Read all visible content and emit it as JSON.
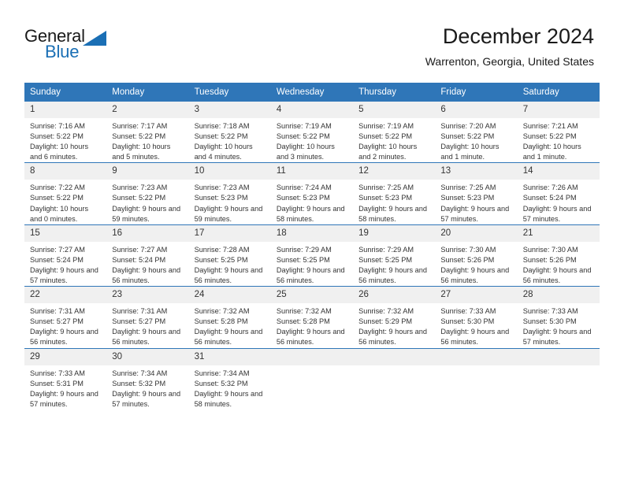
{
  "brand": {
    "name_part1": "General",
    "name_part2": "Blue",
    "triangle_color": "#1a6fb5",
    "text_color_primary": "#1a1a1a",
    "text_color_accent": "#1a6fb5"
  },
  "header": {
    "title": "December 2024",
    "subtitle": "Warrenton, Georgia, United States"
  },
  "theme": {
    "header_bg": "#2f76b8",
    "header_text": "#ffffff",
    "day_number_bg": "#f0f0f0",
    "row_divider": "#2f76b8",
    "body_text": "#333333"
  },
  "calendar": {
    "weekdays": [
      "Sunday",
      "Monday",
      "Tuesday",
      "Wednesday",
      "Thursday",
      "Friday",
      "Saturday"
    ],
    "weeks": [
      [
        {
          "day": "1",
          "sunrise": "Sunrise: 7:16 AM",
          "sunset": "Sunset: 5:22 PM",
          "daylight": "Daylight: 10 hours and 6 minutes."
        },
        {
          "day": "2",
          "sunrise": "Sunrise: 7:17 AM",
          "sunset": "Sunset: 5:22 PM",
          "daylight": "Daylight: 10 hours and 5 minutes."
        },
        {
          "day": "3",
          "sunrise": "Sunrise: 7:18 AM",
          "sunset": "Sunset: 5:22 PM",
          "daylight": "Daylight: 10 hours and 4 minutes."
        },
        {
          "day": "4",
          "sunrise": "Sunrise: 7:19 AM",
          "sunset": "Sunset: 5:22 PM",
          "daylight": "Daylight: 10 hours and 3 minutes."
        },
        {
          "day": "5",
          "sunrise": "Sunrise: 7:19 AM",
          "sunset": "Sunset: 5:22 PM",
          "daylight": "Daylight: 10 hours and 2 minutes."
        },
        {
          "day": "6",
          "sunrise": "Sunrise: 7:20 AM",
          "sunset": "Sunset: 5:22 PM",
          "daylight": "Daylight: 10 hours and 1 minute."
        },
        {
          "day": "7",
          "sunrise": "Sunrise: 7:21 AM",
          "sunset": "Sunset: 5:22 PM",
          "daylight": "Daylight: 10 hours and 1 minute."
        }
      ],
      [
        {
          "day": "8",
          "sunrise": "Sunrise: 7:22 AM",
          "sunset": "Sunset: 5:22 PM",
          "daylight": "Daylight: 10 hours and 0 minutes."
        },
        {
          "day": "9",
          "sunrise": "Sunrise: 7:23 AM",
          "sunset": "Sunset: 5:22 PM",
          "daylight": "Daylight: 9 hours and 59 minutes."
        },
        {
          "day": "10",
          "sunrise": "Sunrise: 7:23 AM",
          "sunset": "Sunset: 5:23 PM",
          "daylight": "Daylight: 9 hours and 59 minutes."
        },
        {
          "day": "11",
          "sunrise": "Sunrise: 7:24 AM",
          "sunset": "Sunset: 5:23 PM",
          "daylight": "Daylight: 9 hours and 58 minutes."
        },
        {
          "day": "12",
          "sunrise": "Sunrise: 7:25 AM",
          "sunset": "Sunset: 5:23 PM",
          "daylight": "Daylight: 9 hours and 58 minutes."
        },
        {
          "day": "13",
          "sunrise": "Sunrise: 7:25 AM",
          "sunset": "Sunset: 5:23 PM",
          "daylight": "Daylight: 9 hours and 57 minutes."
        },
        {
          "day": "14",
          "sunrise": "Sunrise: 7:26 AM",
          "sunset": "Sunset: 5:24 PM",
          "daylight": "Daylight: 9 hours and 57 minutes."
        }
      ],
      [
        {
          "day": "15",
          "sunrise": "Sunrise: 7:27 AM",
          "sunset": "Sunset: 5:24 PM",
          "daylight": "Daylight: 9 hours and 57 minutes."
        },
        {
          "day": "16",
          "sunrise": "Sunrise: 7:27 AM",
          "sunset": "Sunset: 5:24 PM",
          "daylight": "Daylight: 9 hours and 56 minutes."
        },
        {
          "day": "17",
          "sunrise": "Sunrise: 7:28 AM",
          "sunset": "Sunset: 5:25 PM",
          "daylight": "Daylight: 9 hours and 56 minutes."
        },
        {
          "day": "18",
          "sunrise": "Sunrise: 7:29 AM",
          "sunset": "Sunset: 5:25 PM",
          "daylight": "Daylight: 9 hours and 56 minutes."
        },
        {
          "day": "19",
          "sunrise": "Sunrise: 7:29 AM",
          "sunset": "Sunset: 5:25 PM",
          "daylight": "Daylight: 9 hours and 56 minutes."
        },
        {
          "day": "20",
          "sunrise": "Sunrise: 7:30 AM",
          "sunset": "Sunset: 5:26 PM",
          "daylight": "Daylight: 9 hours and 56 minutes."
        },
        {
          "day": "21",
          "sunrise": "Sunrise: 7:30 AM",
          "sunset": "Sunset: 5:26 PM",
          "daylight": "Daylight: 9 hours and 56 minutes."
        }
      ],
      [
        {
          "day": "22",
          "sunrise": "Sunrise: 7:31 AM",
          "sunset": "Sunset: 5:27 PM",
          "daylight": "Daylight: 9 hours and 56 minutes."
        },
        {
          "day": "23",
          "sunrise": "Sunrise: 7:31 AM",
          "sunset": "Sunset: 5:27 PM",
          "daylight": "Daylight: 9 hours and 56 minutes."
        },
        {
          "day": "24",
          "sunrise": "Sunrise: 7:32 AM",
          "sunset": "Sunset: 5:28 PM",
          "daylight": "Daylight: 9 hours and 56 minutes."
        },
        {
          "day": "25",
          "sunrise": "Sunrise: 7:32 AM",
          "sunset": "Sunset: 5:28 PM",
          "daylight": "Daylight: 9 hours and 56 minutes."
        },
        {
          "day": "26",
          "sunrise": "Sunrise: 7:32 AM",
          "sunset": "Sunset: 5:29 PM",
          "daylight": "Daylight: 9 hours and 56 minutes."
        },
        {
          "day": "27",
          "sunrise": "Sunrise: 7:33 AM",
          "sunset": "Sunset: 5:30 PM",
          "daylight": "Daylight: 9 hours and 56 minutes."
        },
        {
          "day": "28",
          "sunrise": "Sunrise: 7:33 AM",
          "sunset": "Sunset: 5:30 PM",
          "daylight": "Daylight: 9 hours and 57 minutes."
        }
      ],
      [
        {
          "day": "29",
          "sunrise": "Sunrise: 7:33 AM",
          "sunset": "Sunset: 5:31 PM",
          "daylight": "Daylight: 9 hours and 57 minutes."
        },
        {
          "day": "30",
          "sunrise": "Sunrise: 7:34 AM",
          "sunset": "Sunset: 5:32 PM",
          "daylight": "Daylight: 9 hours and 57 minutes."
        },
        {
          "day": "31",
          "sunrise": "Sunrise: 7:34 AM",
          "sunset": "Sunset: 5:32 PM",
          "daylight": "Daylight: 9 hours and 58 minutes."
        },
        {
          "day": "",
          "sunrise": "",
          "sunset": "",
          "daylight": ""
        },
        {
          "day": "",
          "sunrise": "",
          "sunset": "",
          "daylight": ""
        },
        {
          "day": "",
          "sunrise": "",
          "sunset": "",
          "daylight": ""
        },
        {
          "day": "",
          "sunrise": "",
          "sunset": "",
          "daylight": ""
        }
      ]
    ]
  }
}
